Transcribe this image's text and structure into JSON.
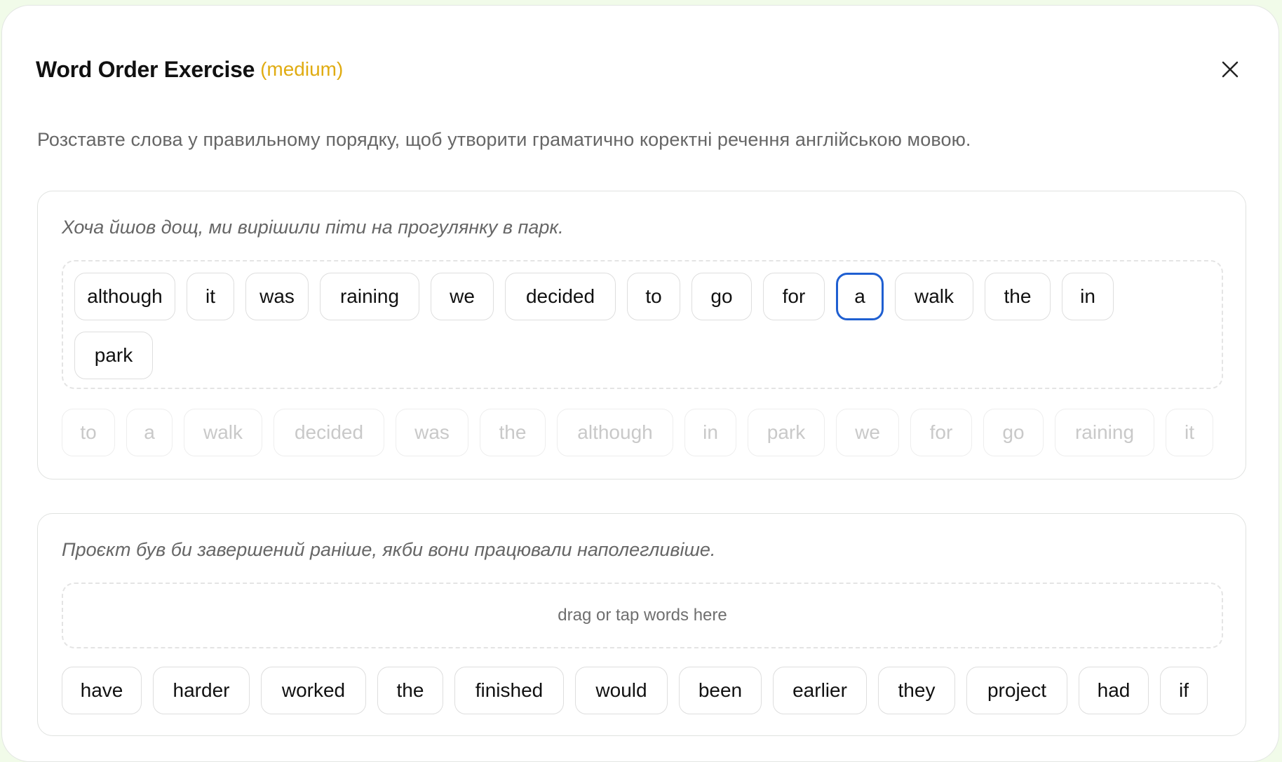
{
  "header": {
    "title": "Word Order Exercise",
    "difficulty": "(medium)"
  },
  "instructions": "Розставте слова у правильному порядку, щоб утворити граматично коректні речення англійською мовою.",
  "exercises": [
    {
      "prompt": "Хоча йшов дощ, ми вирішили піти на прогулянку в парк.",
      "answer_words": [
        "although",
        "it",
        "was",
        "raining",
        "we",
        "decided",
        "to",
        "go",
        "for",
        "a",
        "walk",
        "the",
        "in",
        "park"
      ],
      "selected_answer_word": "a",
      "bank_words": [
        "to",
        "a",
        "walk",
        "decided",
        "was",
        "the",
        "although",
        "in",
        "park",
        "we",
        "for",
        "go",
        "raining",
        "it"
      ],
      "bank_state": "used"
    },
    {
      "prompt": "Проєкт був би завершений раніше, якби вони працювали наполегливіше.",
      "drop_hint": "drag or tap words here",
      "answer_words": [],
      "bank_words": [
        "have",
        "harder",
        "worked",
        "the",
        "finished",
        "would",
        "been",
        "earlier",
        "they",
        "project",
        "had",
        "if"
      ],
      "bank_state": "available"
    }
  ],
  "colors": {
    "accent": "#1f5fd1",
    "difficulty": "#e0ac12",
    "background": "#f1fbe9"
  },
  "icons": {
    "close": "close-icon"
  }
}
